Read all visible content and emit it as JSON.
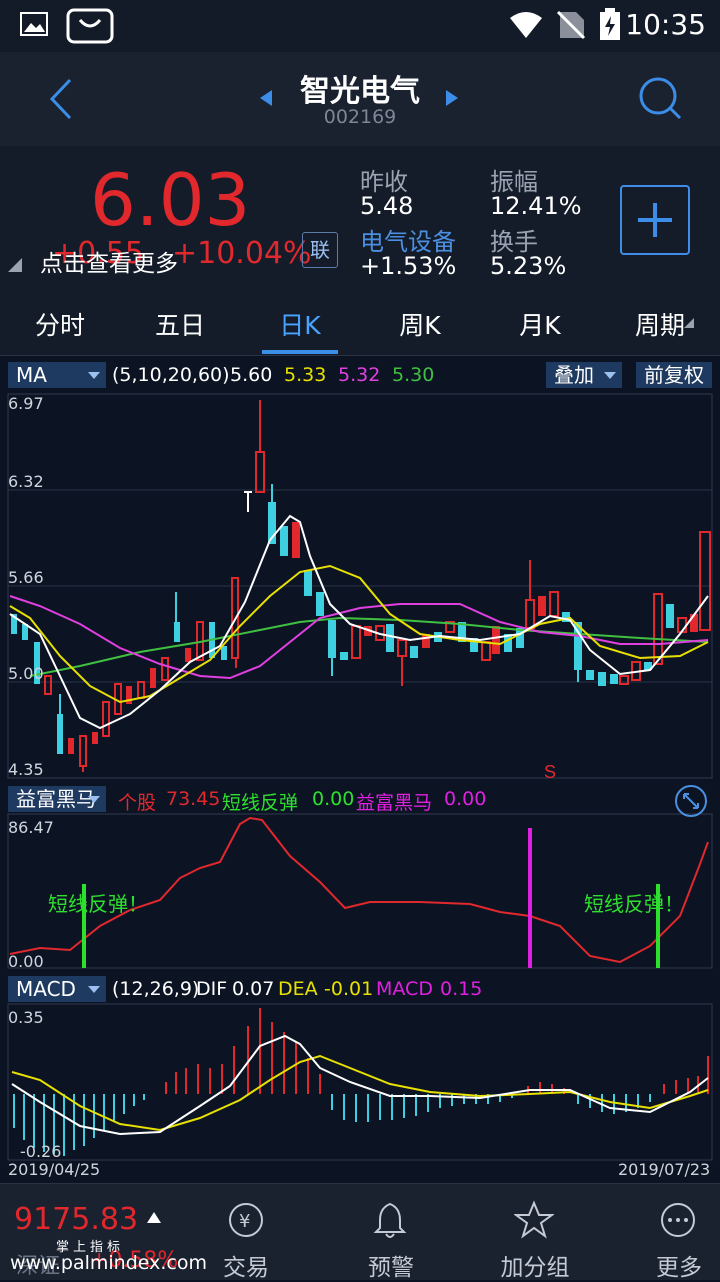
{
  "status": {
    "time": "10:35"
  },
  "nav": {
    "title": "智光电气",
    "code": "002169"
  },
  "quote": {
    "price": "6.03",
    "change": "+0.55",
    "change_pct": "+10.04%",
    "more_label": "点击查看更多",
    "lian_label": "联",
    "prev_close_label": "昨收",
    "prev_close": "5.48",
    "sector_label": "电气设备",
    "sector_change": "+1.53%",
    "amplitude_label": "振幅",
    "amplitude": "12.41%",
    "turnover_label": "换手",
    "turnover": "5.23%"
  },
  "tabs": [
    "分时",
    "五日",
    "日K",
    "周K",
    "月K",
    "周期"
  ],
  "active_tab": "日K",
  "ma": {
    "dropdown": "MA",
    "params": "(5,10,20,60)",
    "v5": "5.60",
    "v10": "5.33",
    "v20": "5.32",
    "v60": "5.30",
    "overlay": "叠加",
    "adjust": "前复权",
    "colors": {
      "ma5": "#ffffff",
      "ma10": "#e8e000",
      "ma20": "#e040e0",
      "ma60": "#40c040"
    }
  },
  "kline_axis": {
    "top": "6.97",
    "l2": "6.32",
    "l3": "5.66",
    "l4": "5.00",
    "bottom": "4.35"
  },
  "sell_marker": "S",
  "indicator": {
    "dropdown": "益富黑马",
    "l1_name": "个股",
    "l1_val": "73.45",
    "l2_name": "短线反弹",
    "l2_val": "0.00",
    "l3_name": "益富黑马",
    "l3_val": "0.00",
    "axis_top": "86.47",
    "axis_bottom": "0.00",
    "rebound_label": "短线反弹！"
  },
  "macd": {
    "dropdown": "MACD",
    "params": "(12,26,9)",
    "dif_label": "DIF",
    "dif": "0.07",
    "dea_label": "DEA",
    "dea": "-0.01",
    "macd_label": "MACD",
    "macd": "0.15",
    "axis_top": "0.35",
    "axis_bottom": "-0.26",
    "date_start": "2019/04/25",
    "date_end": "2019/07/23"
  },
  "bottom": {
    "index_value": "9175.83",
    "index_name": "深证",
    "index_change": "+0.58%",
    "brand": "掌上指标",
    "trade": "交易",
    "alert": "预警",
    "watchlist": "加分组",
    "more": "更多",
    "watermark": "www.palmindex.com"
  }
}
